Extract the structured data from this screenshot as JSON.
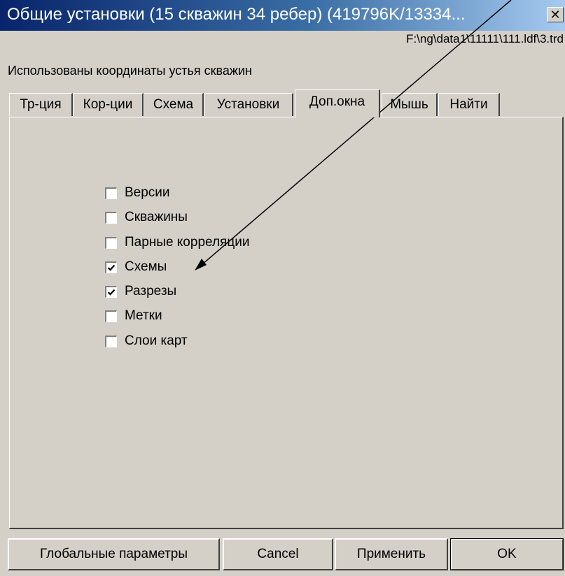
{
  "window": {
    "title": "Общие установки (15 скважин 34 ребер) (419796K/13334...",
    "close_label": "✕",
    "path": "F:\\ng\\data1\\11111\\111.ldf\\3.trd",
    "status": "Использованы координаты устья скважин"
  },
  "tabs": [
    {
      "label": "Тр-ция",
      "active": false
    },
    {
      "label": "Кор-ции",
      "active": false
    },
    {
      "label": "Схема",
      "active": false
    },
    {
      "label": "Установки",
      "active": false
    },
    {
      "label": "Доп.окна",
      "active": true
    },
    {
      "label": "Мышь",
      "active": false
    },
    {
      "label": "Найти",
      "active": false
    }
  ],
  "checkboxes": [
    {
      "label": "Версии",
      "checked": false
    },
    {
      "label": "Скважины",
      "checked": false
    },
    {
      "label": "Парные корреляции",
      "checked": false
    },
    {
      "label": "Схемы",
      "checked": true
    },
    {
      "label": "Разрезы",
      "checked": true
    },
    {
      "label": "Метки",
      "checked": false
    },
    {
      "label": "Слои карт",
      "checked": false
    }
  ],
  "buttons": {
    "global_params": "Глобальные параметры",
    "cancel": "Cancel",
    "apply": "Применить",
    "ok": "OK"
  }
}
